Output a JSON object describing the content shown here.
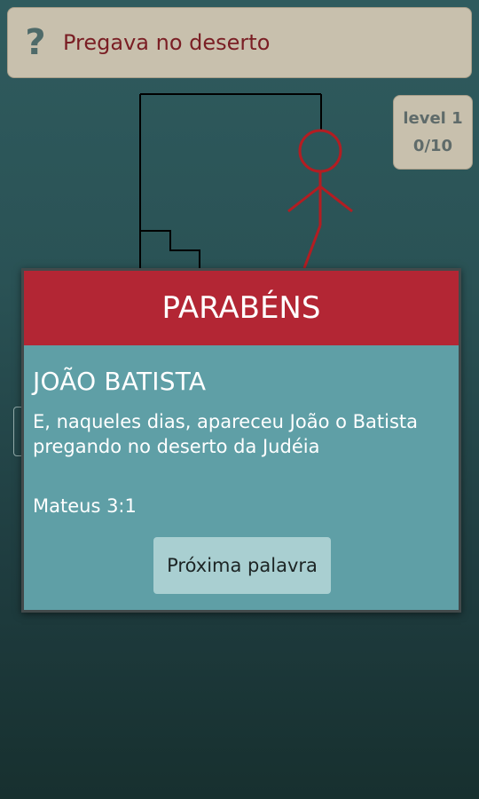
{
  "hint": {
    "icon": "question-mark-icon",
    "icon_glyph": "?",
    "text": "Pregava no deserto"
  },
  "level": {
    "label": "level 1",
    "progress": "0/10"
  },
  "colors": {
    "hint_text": "#7a1e24",
    "panel_bg": "#c8c0ad",
    "dialog_header": "#b32634",
    "dialog_body": "#5f9fa6",
    "hangman_figure": "#b31d22"
  },
  "dialog": {
    "title": "PARABÉNS",
    "answer": "JOÃO BATISTA",
    "verse": "E, naqueles dias, apareceu João o Batista pregando no deserto da Judéia",
    "reference": "Mateus 3:1",
    "next_button": "Próxima palavra"
  }
}
